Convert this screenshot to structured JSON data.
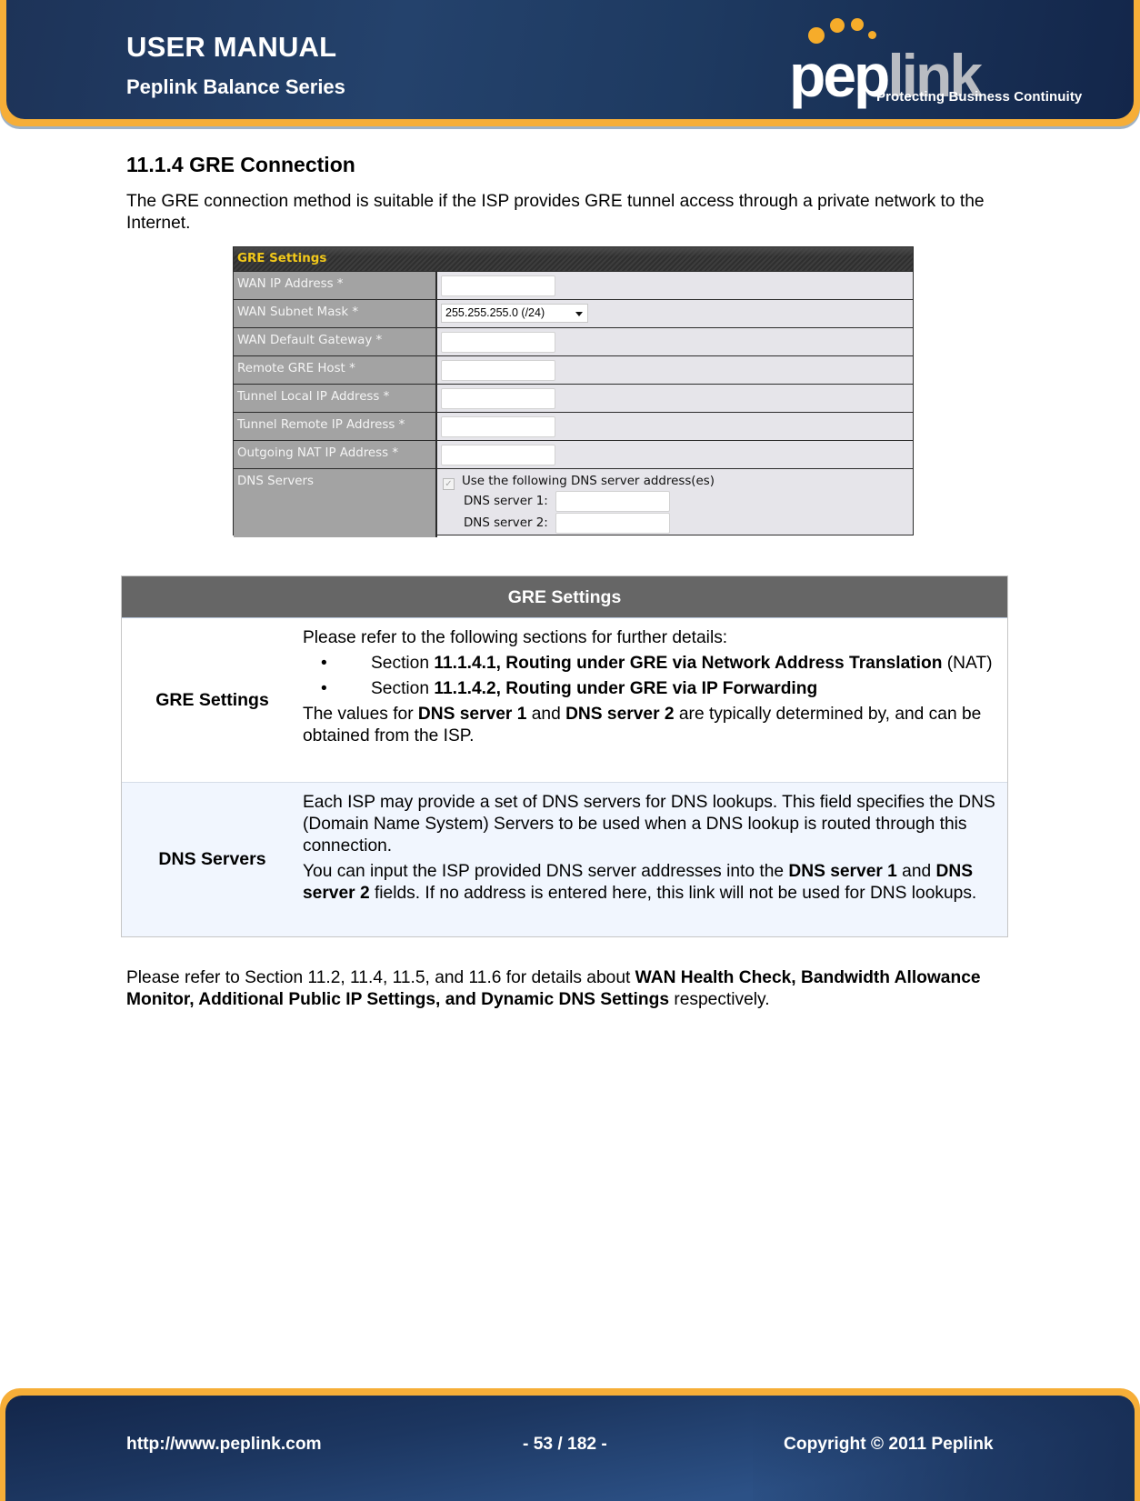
{
  "header": {
    "title": "USER MANUAL",
    "subtitle": "Peplink Balance Series",
    "logo": {
      "word_part1": "pep",
      "word_part2": "link",
      "tagline": "Protecting Business Continuity",
      "dot_color": "#f6ac2a"
    }
  },
  "section": {
    "heading": "11.1.4  GRE Connection",
    "intro": "The GRE connection method is suitable if the ISP provides GRE tunnel access through a private network to the Internet."
  },
  "gre_form": {
    "title": "GRE Settings",
    "rows": [
      {
        "label": "WAN IP Address *",
        "type": "input",
        "value": ""
      },
      {
        "label": "WAN Subnet Mask *",
        "type": "select",
        "value": "255.255.255.0 (/24)"
      },
      {
        "label": "WAN Default Gateway *",
        "type": "input",
        "value": ""
      },
      {
        "label": "Remote GRE Host *",
        "type": "input",
        "value": ""
      },
      {
        "label": "Tunnel Local IP Address *",
        "type": "input",
        "value": ""
      },
      {
        "label": "Tunnel Remote IP Address *",
        "type": "input",
        "value": ""
      },
      {
        "label": "Outgoing NAT IP Address *",
        "type": "input",
        "value": ""
      }
    ],
    "dns": {
      "label": "DNS Servers",
      "checkbox_label": "Use the following DNS server address(es)",
      "checkbox_checked": true,
      "server1_label": "DNS server 1:",
      "server1_value": "",
      "server2_label": "DNS server 2:",
      "server2_value": ""
    }
  },
  "desc_table": {
    "header": "GRE Settings",
    "rows": [
      {
        "key": "GRE Settings",
        "intro": "Please refer to the following sections for further details:",
        "bullets": [
          {
            "prefix": "Section ",
            "bold": "11.1.4.1, Routing under GRE via Network Address Translation",
            "suffix": " (NAT)"
          },
          {
            "prefix": "Section ",
            "bold": "11.1.4.2, Routing under GRE via IP Forwarding",
            "suffix": ""
          }
        ],
        "note_1": "The values for ",
        "note_b1": "DNS server 1",
        "note_2": " and ",
        "note_b2": "DNS server 2",
        "note_3": " are typically determined by, and can be obtained from the ISP."
      },
      {
        "key": "DNS Servers",
        "para1": "Each ISP may provide a set of DNS servers for DNS lookups.  This field specifies the DNS (Domain Name System) Servers to be used when a DNS lookup is routed through this connection.",
        "p2_1": "You can input the ISP provided DNS server addresses into the ",
        "p2_b1": "DNS server 1",
        "p2_2": " and ",
        "p2_b2": "DNS server 2",
        "p2_3": " fields.  If no address is entered here, this link will not be used for DNS lookups."
      }
    ]
  },
  "closing": {
    "text_1": "Please refer to Section 11.2, 11.4, 11.5, and 11.6 for details about ",
    "bold": "WAN Health Check, Bandwidth Allowance Monitor, Additional Public IP Settings, and Dynamic DNS Settings",
    "text_2": " respectively."
  },
  "footer": {
    "url": "http://www.peplink.com",
    "page": "- 53 / 182 -",
    "copyright": "Copyright © 2011 Peplink"
  }
}
